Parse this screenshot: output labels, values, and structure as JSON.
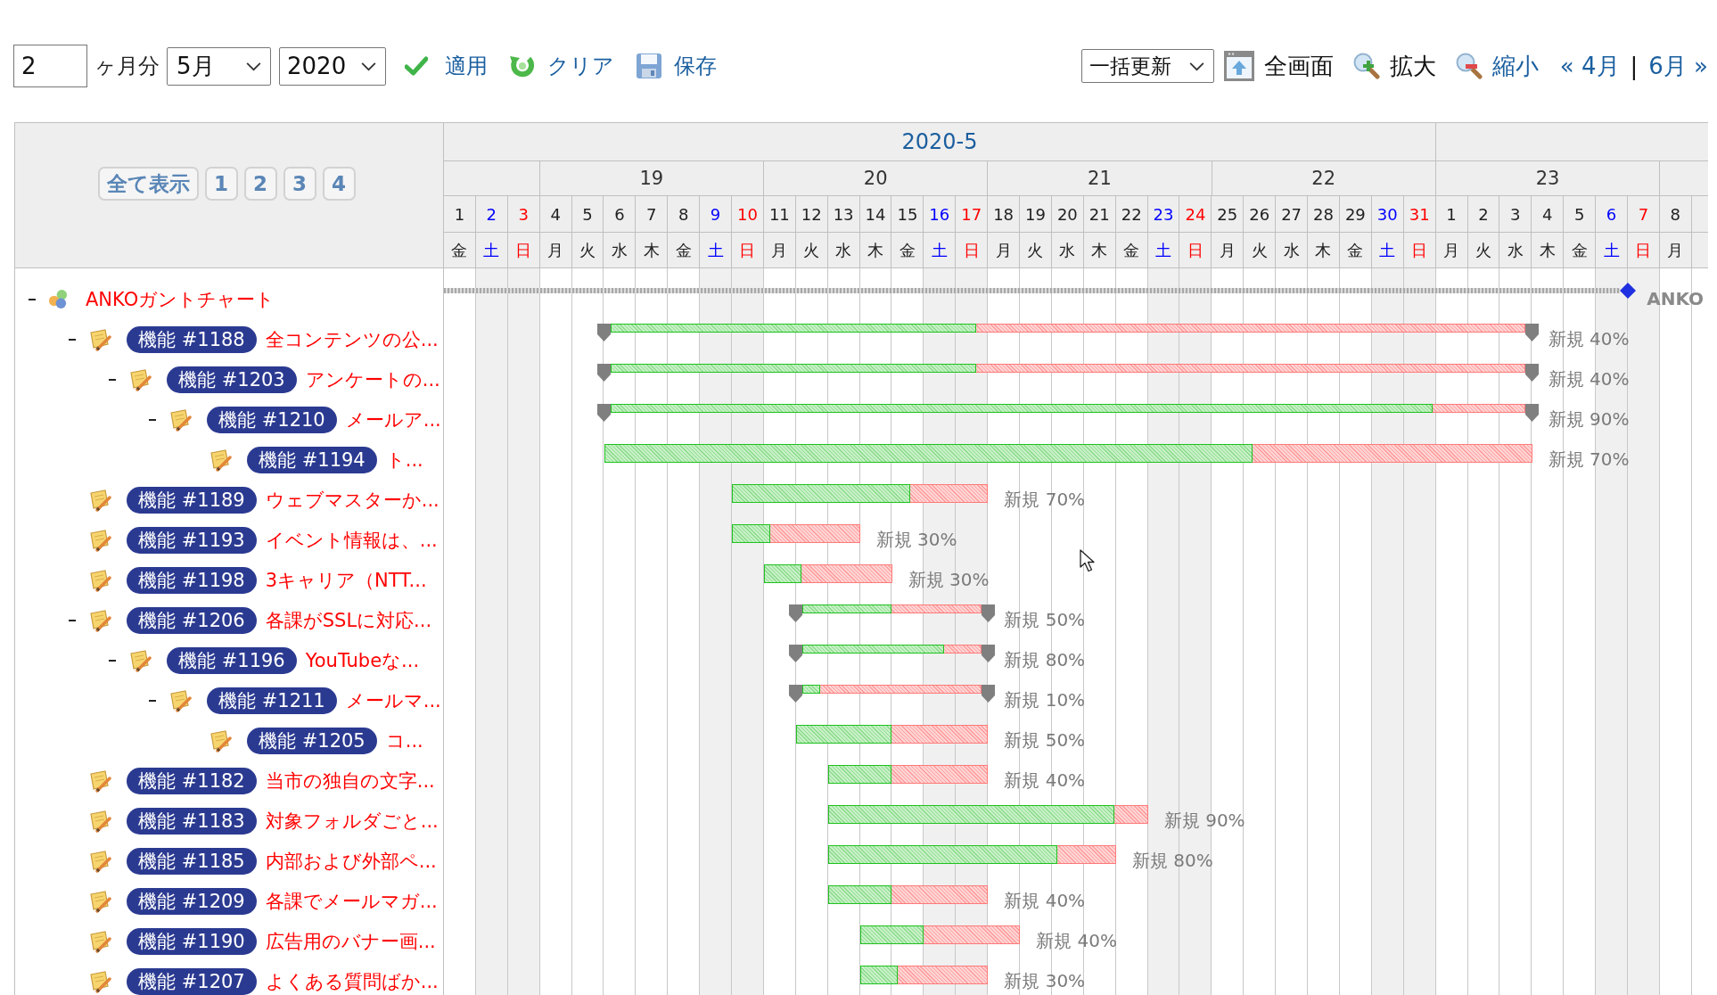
{
  "toolbar": {
    "months_field": {
      "value": "2"
    },
    "months_unit": "ヶ月分",
    "month_select": {
      "value": "5月"
    },
    "year_select": {
      "value": "2020"
    },
    "actions": [
      {
        "kind": "apply",
        "label": "適用",
        "disabled": false
      },
      {
        "kind": "clear",
        "label": "クリア",
        "disabled": false
      },
      {
        "kind": "save",
        "label": "保存",
        "disabled": false
      }
    ],
    "bulk_select": {
      "value": "一括更新"
    },
    "view_actions": [
      {
        "kind": "fullscreen",
        "label": "全画面",
        "disabled": true
      },
      {
        "kind": "zoom_in",
        "label": "拡大",
        "disabled": true
      },
      {
        "kind": "zoom_out",
        "label": "縮小",
        "disabled": false
      }
    ],
    "prev_link": "« 4月",
    "separator": "|",
    "next_link": "6月 »"
  },
  "level_buttons": [
    "全て表示",
    "1",
    "2",
    "3",
    "4"
  ],
  "timeline": {
    "months": [
      {
        "label": "2020-5",
        "days": [
          {
            "day": "1",
            "weekday": "金",
            "kind": "weekday"
          },
          {
            "day": "2",
            "weekday": "土",
            "kind": "saturday"
          },
          {
            "day": "3",
            "weekday": "日",
            "kind": "sunday"
          },
          {
            "day": "4",
            "weekday": "月",
            "kind": "weekday"
          },
          {
            "day": "5",
            "weekday": "火",
            "kind": "weekday"
          },
          {
            "day": "6",
            "weekday": "水",
            "kind": "weekday"
          },
          {
            "day": "7",
            "weekday": "木",
            "kind": "weekday"
          },
          {
            "day": "8",
            "weekday": "金",
            "kind": "weekday"
          },
          {
            "day": "9",
            "weekday": "土",
            "kind": "saturday"
          },
          {
            "day": "10",
            "weekday": "日",
            "kind": "sunday"
          },
          {
            "day": "11",
            "weekday": "月",
            "kind": "weekday"
          },
          {
            "day": "12",
            "weekday": "火",
            "kind": "weekday"
          },
          {
            "day": "13",
            "weekday": "水",
            "kind": "weekday"
          },
          {
            "day": "14",
            "weekday": "木",
            "kind": "weekday"
          },
          {
            "day": "15",
            "weekday": "金",
            "kind": "weekday"
          },
          {
            "day": "16",
            "weekday": "土",
            "kind": "saturday"
          },
          {
            "day": "17",
            "weekday": "日",
            "kind": "sunday"
          },
          {
            "day": "18",
            "weekday": "月",
            "kind": "weekday"
          },
          {
            "day": "19",
            "weekday": "火",
            "kind": "weekday"
          },
          {
            "day": "20",
            "weekday": "水",
            "kind": "weekday"
          },
          {
            "day": "21",
            "weekday": "木",
            "kind": "weekday"
          },
          {
            "day": "22",
            "weekday": "金",
            "kind": "weekday"
          },
          {
            "day": "23",
            "weekday": "土",
            "kind": "saturday"
          },
          {
            "day": "24",
            "weekday": "日",
            "kind": "sunday"
          },
          {
            "day": "25",
            "weekday": "月",
            "kind": "weekday"
          },
          {
            "day": "26",
            "weekday": "火",
            "kind": "weekday"
          },
          {
            "day": "27",
            "weekday": "水",
            "kind": "weekday"
          },
          {
            "day": "28",
            "weekday": "木",
            "kind": "weekday"
          },
          {
            "day": "29",
            "weekday": "金",
            "kind": "weekday"
          },
          {
            "day": "30",
            "weekday": "土",
            "kind": "saturday"
          },
          {
            "day": "31",
            "weekday": "日",
            "kind": "sunday"
          }
        ]
      },
      {
        "days": [
          {
            "day": "1",
            "weekday": "月",
            "kind": "weekday"
          },
          {
            "day": "2",
            "weekday": "火",
            "kind": "weekday"
          },
          {
            "day": "3",
            "weekday": "水",
            "kind": "weekday"
          },
          {
            "day": "4",
            "weekday": "木",
            "kind": "weekday"
          },
          {
            "day": "5",
            "weekday": "金",
            "kind": "weekday"
          },
          {
            "day": "6",
            "weekday": "土",
            "kind": "saturday"
          },
          {
            "day": "7",
            "weekday": "日",
            "kind": "sunday"
          },
          {
            "day": "8",
            "weekday": "月",
            "kind": "weekday"
          }
        ]
      }
    ],
    "weeks": [
      "19",
      "20",
      "21",
      "22",
      "23"
    ]
  },
  "tree": {
    "label": "ANKOガントチャート",
    "expanded": true,
    "bar_label": "ANKO",
    "children": [
      {
        "tracker": "機能 #1188",
        "title": "全コンテンツの公...",
        "expanded": true,
        "level": 0.4,
        "bar_label": "新規 40%",
        "children": [
          {
            "tracker": "機能 #1203",
            "title": "アンケートの...",
            "expanded": true,
            "level": 0.4,
            "bar_label": "新規 40%",
            "children": [
              {
                "tracker": "機能 #1210",
                "title": "メールア...",
                "expanded": true,
                "level": 0.9,
                "bar_label": "新規 90%",
                "children": [
                  {
                    "tracker": "機能 #1194",
                    "title": "ト...",
                    "level": 0.7,
                    "bar_label": "新規 70%"
                  }
                ]
              }
            ]
          }
        ]
      },
      {
        "tracker": "機能 #1189",
        "title": "ウェブマスターか...",
        "level": 0.7,
        "bar_label": "新規 70%"
      },
      {
        "tracker": "機能 #1193",
        "title": "イベント情報は、...",
        "level": 0.3,
        "bar_label": "新規 30%"
      },
      {
        "tracker": "機能 #1198",
        "title": "3キャリア（NTT...",
        "level": 0.3,
        "bar_label": "新規 30%"
      },
      {
        "tracker": "機能 #1206",
        "title": "各課がSSLに対応...",
        "expanded": true,
        "level": 0.5,
        "bar_label": "新規 50%",
        "children": [
          {
            "tracker": "機能 #1196",
            "title": "YouTubeな...",
            "expanded": true,
            "level": 0.8,
            "bar_label": "新規 80%",
            "children": [
              {
                "tracker": "機能 #1211",
                "title": "メールマ...",
                "expanded": true,
                "level": 0.1,
                "bar_label": "新規 10%",
                "children": [
                  {
                    "tracker": "機能 #1205",
                    "title": "コ...",
                    "level": 0.5,
                    "bar_label": "新規 50%"
                  }
                ]
              }
            ]
          }
        ]
      },
      {
        "tracker": "機能 #1182",
        "title": "当市の独自の文字...",
        "level": 0.4,
        "bar_label": "新規 40%"
      },
      {
        "tracker": "機能 #1183",
        "title": "対象フォルダごと...",
        "level": 0.9,
        "bar_label": "新規 90%"
      },
      {
        "tracker": "機能 #1185",
        "title": "内部および外部ペ...",
        "level": 0.8,
        "bar_label": "新規 80%"
      },
      {
        "tracker": "機能 #1209",
        "title": "各課でメールマガ...",
        "level": 0.4,
        "bar_label": "新規 40%"
      },
      {
        "tracker": "機能 #1190",
        "title": "広告用のバナー画...",
        "level": 0.4,
        "bar_label": "新規 40%"
      },
      {
        "tracker": "機能 #1207",
        "title": "よくある質問ばか...",
        "level": 0.3,
        "bar_label": "新規 30%"
      }
    ]
  }
}
